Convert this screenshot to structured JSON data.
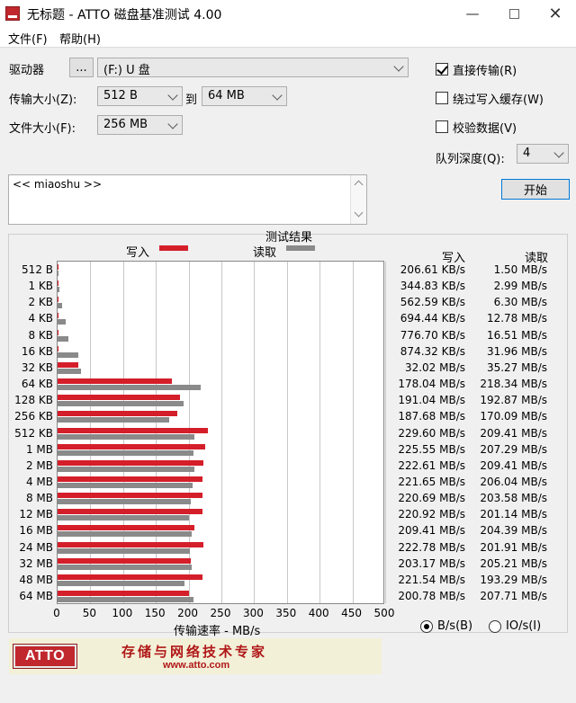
{
  "window": {
    "title": "无标题 - ATTO 磁盘基准测试 4.00",
    "minimize": "—",
    "close": "✕"
  },
  "menu": {
    "file": "文件(F)",
    "help": "帮助(H)"
  },
  "form": {
    "drive_label": "驱动器",
    "browse_label": "...",
    "drive_value": "(F:) U 盘",
    "transfer_size_label": "传输大小(Z):",
    "transfer_from": "512 B",
    "to_label": "到",
    "transfer_to": "64 MB",
    "file_size_label": "文件大小(F):",
    "file_size": "256 MB",
    "description": "<< miaoshu >>"
  },
  "options": {
    "direct_io": {
      "label": "直接传输(R)",
      "checked": true
    },
    "bypass_cache": {
      "label": "绕过写入缓存(W)",
      "checked": false
    },
    "verify": {
      "label": "校验数据(V)",
      "checked": false
    },
    "queue_depth_label": "队列深度(Q):",
    "queue_depth": "4",
    "start_button": "开始"
  },
  "results": {
    "title": "测试结果",
    "legend_write": "写入",
    "legend_read": "读取",
    "col_write": "写入",
    "col_read": "读取",
    "xlabel": "传输速率 - MB/s",
    "unit_bytes": "B/s(B)",
    "unit_io": "IO/s(I)",
    "unit_selected": "B/s"
  },
  "chart_data": {
    "type": "bar",
    "orientation": "horizontal",
    "xlim": [
      0,
      500
    ],
    "xticks": [
      "0",
      "50",
      "100",
      "150",
      "200",
      "250",
      "300",
      "350",
      "400",
      "450",
      "500"
    ],
    "categories": [
      "512 B",
      "1 KB",
      "2 KB",
      "4 KB",
      "8 KB",
      "16 KB",
      "32 KB",
      "64 KB",
      "128 KB",
      "256 KB",
      "512 KB",
      "1 MB",
      "2 MB",
      "4 MB",
      "8 MB",
      "12 MB",
      "16 MB",
      "24 MB",
      "32 MB",
      "48 MB",
      "64 MB"
    ],
    "series": [
      {
        "name": "写入",
        "color": "#d41f2a",
        "values": [
          0.2,
          0.34,
          0.55,
          0.68,
          0.76,
          0.85,
          31.3,
          173.8,
          186.5,
          183.3,
          229.6,
          225.6,
          222.6,
          221.7,
          220.7,
          220.9,
          209.4,
          222.8,
          203.2,
          221.5,
          200.8
        ],
        "labels": [
          "206.61 KB/s",
          "344.83 KB/s",
          "562.59 KB/s",
          "694.44 KB/s",
          "776.70 KB/s",
          "874.32 KB/s",
          "32.02 MB/s",
          "178.04 MB/s",
          "191.04 MB/s",
          "187.68 MB/s",
          "229.60 MB/s",
          "225.55 MB/s",
          "222.61 MB/s",
          "221.65 MB/s",
          "220.69 MB/s",
          "220.92 MB/s",
          "209.41 MB/s",
          "222.78 MB/s",
          "203.17 MB/s",
          "221.54 MB/s",
          "200.78 MB/s"
        ]
      },
      {
        "name": "读取",
        "color": "#8a8a8a",
        "values": [
          1.5,
          2.99,
          6.3,
          12.78,
          16.51,
          31.96,
          35.27,
          218.34,
          192.87,
          170.09,
          209.41,
          207.29,
          209.41,
          206.04,
          203.58,
          201.14,
          204.39,
          201.91,
          205.21,
          193.29,
          207.71
        ],
        "labels": [
          "1.50 MB/s",
          "2.99 MB/s",
          "6.30 MB/s",
          "12.78 MB/s",
          "16.51 MB/s",
          "31.96 MB/s",
          "35.27 MB/s",
          "218.34 MB/s",
          "192.87 MB/s",
          "170.09 MB/s",
          "209.41 MB/s",
          "207.29 MB/s",
          "209.41 MB/s",
          "206.04 MB/s",
          "203.58 MB/s",
          "201.14 MB/s",
          "204.39 MB/s",
          "201.91 MB/s",
          "205.21 MB/s",
          "193.29 MB/s",
          "207.71 MB/s"
        ]
      }
    ],
    "title": "测试结果",
    "xlabel": "传输速率 - MB/s",
    "legend": "top-center"
  },
  "banner": {
    "logo": "ATTO",
    "slogan": "存储与网络技术专家",
    "url": "www.atto.com"
  }
}
